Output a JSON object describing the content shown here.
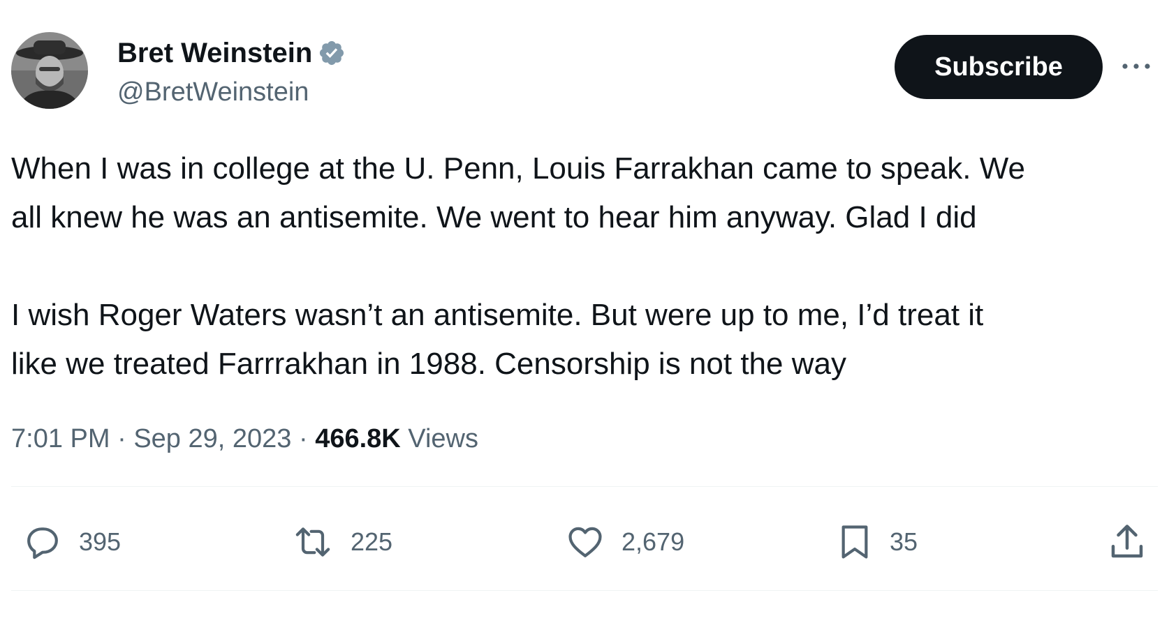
{
  "author": {
    "name": "Bret Weinstein",
    "handle": "@BretWeinstein",
    "verified_icon": "verified-badge-icon"
  },
  "header": {
    "subscribe_label": "Subscribe",
    "more_icon": "more-dots-icon"
  },
  "tweet": {
    "paragraphs": [
      "When I was in college at the U. Penn, Louis Farrakhan came to speak. We",
      "all knew he was an antisemite. We went to hear him anyway. Glad I did",
      "I wish Roger Waters wasn’t an antisemite. But were up to me, I’d treat it",
      "like we treated Farrrakhan in 1988. Censorship is not the way"
    ]
  },
  "meta": {
    "time": "7:01 PM",
    "sep1": " · ",
    "date": "Sep 29, 2023",
    "sep2": " · ",
    "views_count": "466.8K",
    "views_label": " Views"
  },
  "actions": {
    "replies": "395",
    "reposts": "225",
    "likes": "2,679",
    "bookmarks": "35"
  },
  "colors": {
    "text_primary": "#0f1419",
    "text_secondary": "#536471",
    "verified_badge": "#829aab",
    "button_bg": "#0f1419",
    "divider": "#eff3f4"
  }
}
